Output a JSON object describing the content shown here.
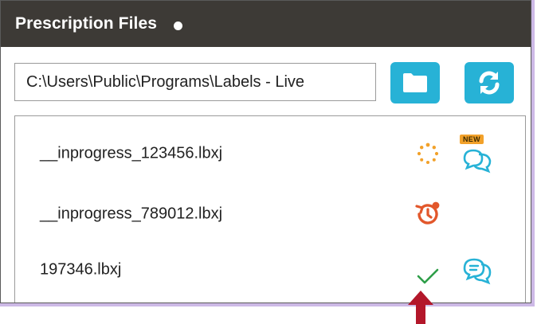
{
  "header": {
    "title": "Prescription Files"
  },
  "path": {
    "value": "C:\\Users\\Public\\Programs\\Labels - Live"
  },
  "files": [
    {
      "name": "__inprogress_123456.lbxj",
      "status": "loading-spinner-icon",
      "chat": "new-message-icon",
      "badge": "NEW"
    },
    {
      "name": "__inprogress_789012.lbxj",
      "status": "history-alert-icon",
      "chat": "",
      "badge": ""
    },
    {
      "name": "197346.lbxj",
      "status": "checkmark-icon",
      "chat": "message-icon",
      "badge": ""
    }
  ],
  "colors": {
    "header_bg": "#3d3a36",
    "button_bg": "#27b2d6",
    "spinner": "#f2a12a",
    "history": "#e2572b",
    "check": "#2e9e48",
    "chat": "#27b2d6",
    "arrow": "#b3172a",
    "frame": "#cdb9e6"
  }
}
